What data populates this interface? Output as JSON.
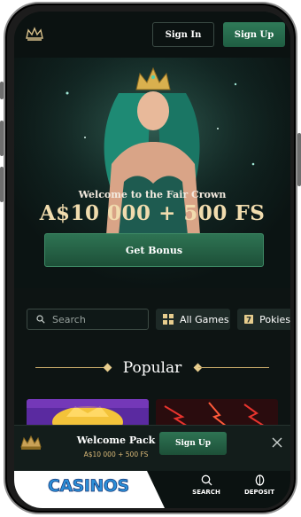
{
  "header": {
    "sign_in_label": "Sign In",
    "sign_up_label": "Sign Up"
  },
  "hero": {
    "welcome_text": "Welcome to the Fair Crown",
    "bonus_amount": "A$10 000 + 500 FS",
    "cta_label": "Get Bonus"
  },
  "search": {
    "placeholder": "Search"
  },
  "categories": [
    {
      "label": "All Games",
      "icon": "grid-icon"
    },
    {
      "label": "Pokies",
      "icon": "slot-machine-icon"
    }
  ],
  "section": {
    "title": "Popular"
  },
  "welcome_pack": {
    "title": "Welcome Pack",
    "subtitle": "A$10 000 + 500 FS",
    "sign_up_label": "Sign Up"
  },
  "bottom_nav": {
    "brand": "CASINOS",
    "items": [
      {
        "label": "SEARCH",
        "icon": "search-icon"
      },
      {
        "label": "DEPOSIT",
        "icon": "deposit-icon"
      }
    ]
  },
  "colors": {
    "accent_green": "#2e7353",
    "gold": "#e7cd8e",
    "background": "#0d1413"
  }
}
